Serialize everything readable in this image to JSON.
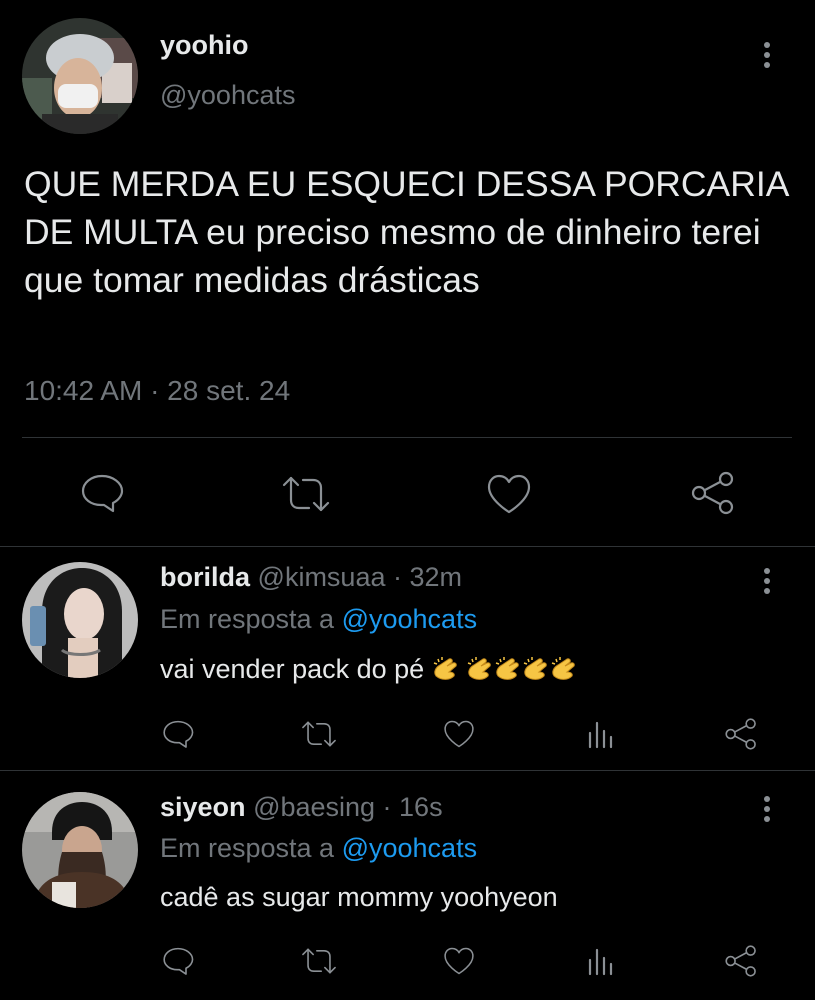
{
  "main_tweet": {
    "display_name": "yoohio",
    "handle": "@yoohcats",
    "text": "QUE MERDA EU ESQUECI DESSA PORCARIA DE MULTA eu preciso mesmo de dinheiro terei que tomar medidas drásticas",
    "timestamp": "10:42 AM · 28 set. 24",
    "avatar_colors": {
      "bg": "#3a3f3c",
      "hat": "#c9cdd0",
      "mask": "#f1f1f1",
      "skin": "#d7b49a"
    }
  },
  "replies": [
    {
      "display_name": "borilda",
      "handle_time": "@kimsuaa · 32m",
      "reply_prefix": "Em resposta a",
      "reply_to": "@yoohcats",
      "text": "vai vender pack do pé",
      "emoji": [
        "clapping-hands",
        "clapping-hands",
        "clapping-hands",
        "clapping-hands",
        "clapping-hands"
      ],
      "avatar_colors": {
        "bg": "#bdbdbd",
        "hair": "#1b1b1b",
        "skin": "#e9d6cc"
      }
    },
    {
      "display_name": "siyeon",
      "handle_time": "@baesing · 16s",
      "reply_prefix": "Em resposta a",
      "reply_to": "@yoohcats",
      "text": "cadê as sugar mommy yoohyeon",
      "avatar_colors": {
        "bg": "#9a9a98",
        "hat": "#151515",
        "skin": "#c9a58e",
        "coat": "#4a3326"
      }
    }
  ],
  "colors": {
    "background": "#000000",
    "text": "#e7e9ea",
    "muted": "#71767b",
    "link": "#1d9bf0",
    "icon": "#8b9095",
    "divider": "#2f3336"
  }
}
